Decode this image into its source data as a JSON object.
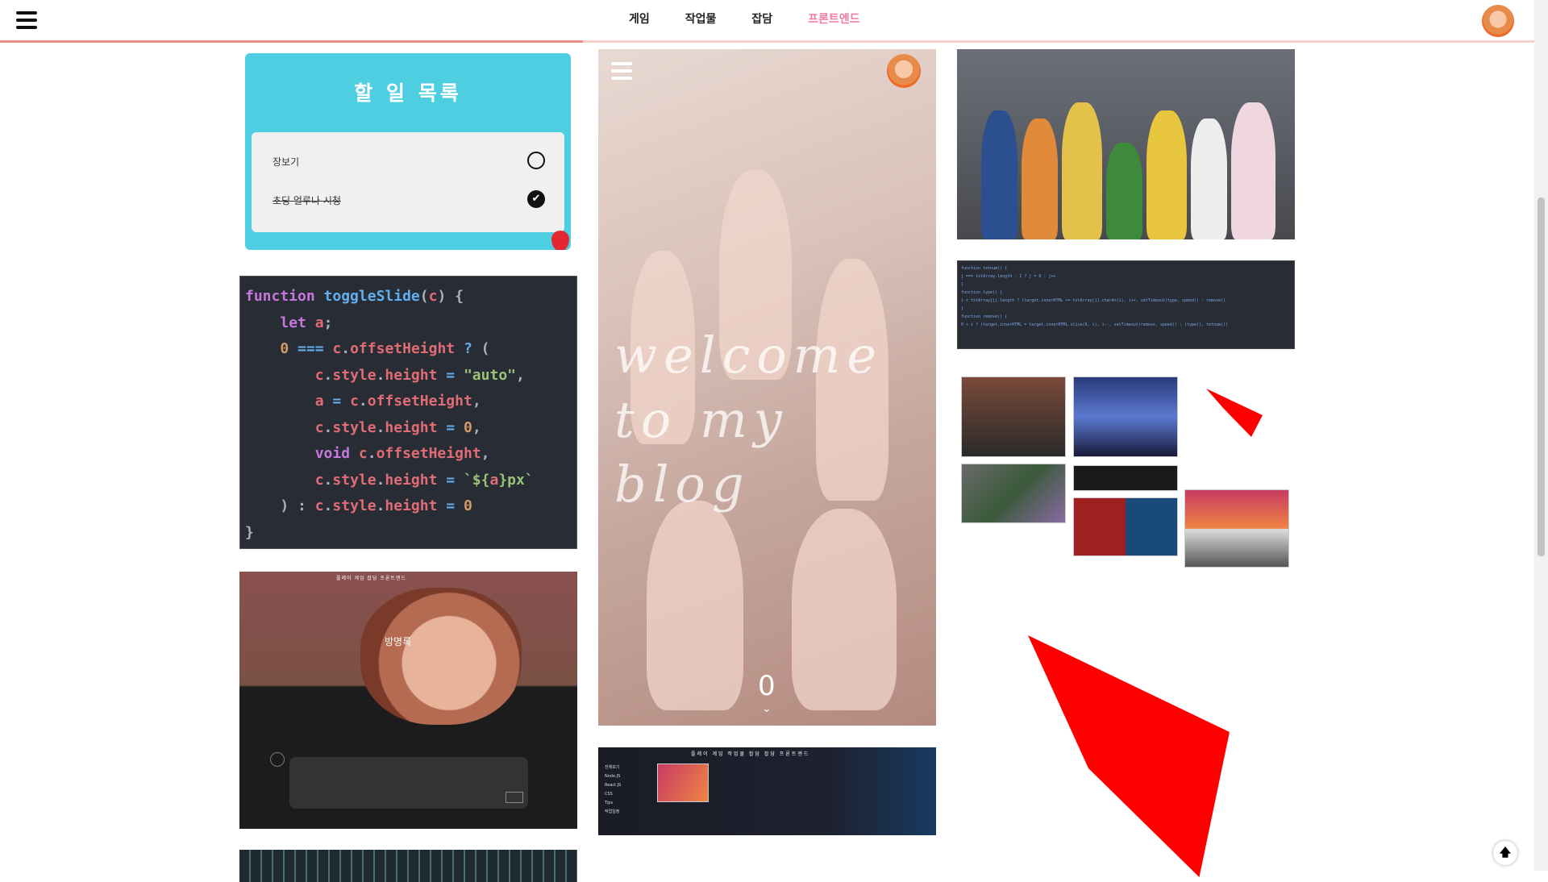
{
  "header": {
    "nav": [
      {
        "label": "게임",
        "active": false
      },
      {
        "label": "작업물",
        "active": false
      },
      {
        "label": "잡담",
        "active": false
      },
      {
        "label": "프론트엔드",
        "active": true
      }
    ],
    "scroll_progress_percent": 38,
    "accent_color": "#f07aa5",
    "progress_color": "#ee8a86"
  },
  "todo": {
    "title": "할 일 목록",
    "items": [
      {
        "text": "장보기",
        "done": false
      },
      {
        "text": "초딩 얼루나 시청",
        "done": true
      }
    ],
    "bg_color": "#4ecfe1"
  },
  "code_snippet": {
    "lines": [
      "function toggleSlide(c) {",
      "    let a;",
      "    0 === c.offsetHeight ? (",
      "        c.style.height = \"auto\",",
      "        a = c.offsetHeight,",
      "        c.style.height = 0,",
      "        void c.offsetHeight,",
      "        c.style.height = `${a}px`",
      "    ) : c.style.height = 0",
      "}"
    ]
  },
  "guestbook": {
    "label": "방명록",
    "menu": "플레이   게임   잡담   프론트엔드"
  },
  "poster": {
    "line1": "welcome",
    "line2": "to my blog",
    "counter": "0",
    "chevron": "⌄"
  },
  "dark_card": {
    "menu": "플레이  게임  작업물 잡담  잡담  프론트엔드",
    "side_items": [
      "전체보기",
      "Node.JS",
      "React.JS",
      "CSS",
      "Tips",
      "작업일정"
    ]
  },
  "code_small": {
    "lines": [
      "function tetnum() {",
      "  j === txtArray.length - 1 ? j = 0 : j++",
      "}",
      "function type() {",
      "  i < txtArray[j].length ? (target.innerHTML += txtArray[j].charAt(i), i++, setTimeout(type, speed)) : remove()",
      "}",
      "function remove() {",
      "  0 < i ? (target.innerHTML = target.innerHTML.slice(0, i), i--, setTimeout(remove, speed)) : (type(), tetnum())"
    ]
  },
  "top_button": {
    "icon": "arrow-up-icon",
    "glyph": "🡅"
  },
  "icons": {
    "menu": "hamburger-menu-icon",
    "avatar": "profile-avatar",
    "check": "✔"
  }
}
